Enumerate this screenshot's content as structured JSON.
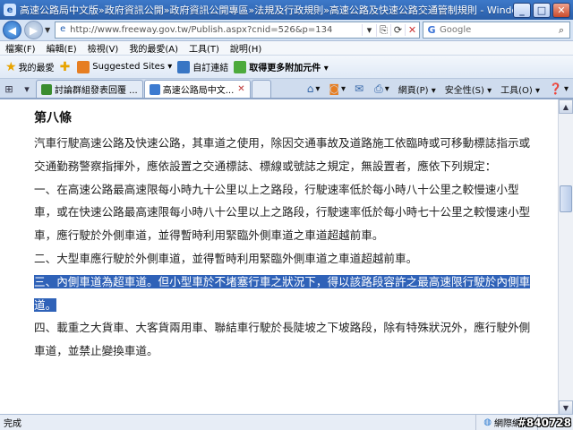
{
  "window": {
    "title": "高速公路局中文版»政府資訊公開»政府資訊公開專區»法規及行政規則»高速公路及快速公路交通管制規則 - Windows Internet E..."
  },
  "address": {
    "url": "http://www.freeway.gov.tw/Publish.aspx?cnid=526&p=134",
    "search_placeholder": "Google"
  },
  "menu": [
    "檔案(F)",
    "編輯(E)",
    "檢視(V)",
    "我的最愛(A)",
    "工具(T)",
    "說明(H)"
  ],
  "favorites": {
    "my_favorites": "我的最愛",
    "suggested": "Suggested Sites ▾",
    "custom_links": "自訂連結",
    "addons": "取得更多附加元件 ▾"
  },
  "tabs": [
    {
      "label": "討論群組發表回覆 ..."
    },
    {
      "label": "高速公路局中文..."
    }
  ],
  "commands": {
    "page": "網頁(P) ▾",
    "safety": "安全性(S) ▾",
    "tools": "工具(O) ▾"
  },
  "article": {
    "heading": "第八條",
    "p1": "汽車行駛高速公路及快速公路，其車道之使用，除因交通事故及道路施工依臨時或可移動標誌指示或交通勤務警察指揮外，應依設置之交通標誌、標線或號誌之規定，無設置者，應依下列規定：",
    "p2": "一、在高速公路最高速限每小時九十公里以上之路段，行駛速率低於每小時八十公里之較慢速小型車，或在快速公路最高速限每小時八十公里以上之路段，行駛速率低於每小時七十公里之較慢速小型車，應行駛於外側車道，並得暫時利用緊臨外側車道之車道超越前車。",
    "p3": "二、大型車應行駛於外側車道，並得暫時利用緊臨外側車道之車道超越前車。",
    "p4": "三、內側車道為超車道。但小型車於不堵塞行車之狀況下，得以該路段容許之最高速限行駛於內側車道。",
    "p5": "四、載重之大貨車、大客貨兩用車、聯結車行駛於長陡坡之下坡路段，除有特殊狀況外，應行駛外側車道，並禁止變換車道。"
  },
  "status": {
    "text": "完成",
    "zone": "網際網路",
    "watermark": "#840728"
  }
}
